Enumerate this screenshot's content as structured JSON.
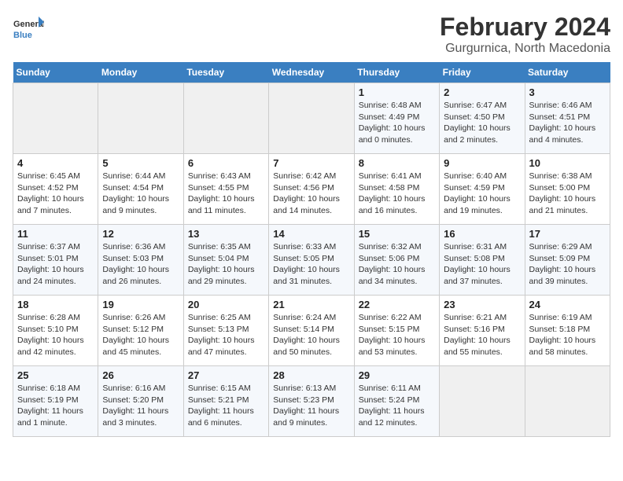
{
  "logo": {
    "line1": "General",
    "line2": "Blue"
  },
  "title": "February 2024",
  "subtitle": "Gurgurnica, North Macedonia",
  "days_header": [
    "Sunday",
    "Monday",
    "Tuesday",
    "Wednesday",
    "Thursday",
    "Friday",
    "Saturday"
  ],
  "weeks": [
    [
      {
        "day": "",
        "info": ""
      },
      {
        "day": "",
        "info": ""
      },
      {
        "day": "",
        "info": ""
      },
      {
        "day": "",
        "info": ""
      },
      {
        "day": "1",
        "info": "Sunrise: 6:48 AM\nSunset: 4:49 PM\nDaylight: 10 hours\nand 0 minutes."
      },
      {
        "day": "2",
        "info": "Sunrise: 6:47 AM\nSunset: 4:50 PM\nDaylight: 10 hours\nand 2 minutes."
      },
      {
        "day": "3",
        "info": "Sunrise: 6:46 AM\nSunset: 4:51 PM\nDaylight: 10 hours\nand 4 minutes."
      }
    ],
    [
      {
        "day": "4",
        "info": "Sunrise: 6:45 AM\nSunset: 4:52 PM\nDaylight: 10 hours\nand 7 minutes."
      },
      {
        "day": "5",
        "info": "Sunrise: 6:44 AM\nSunset: 4:54 PM\nDaylight: 10 hours\nand 9 minutes."
      },
      {
        "day": "6",
        "info": "Sunrise: 6:43 AM\nSunset: 4:55 PM\nDaylight: 10 hours\nand 11 minutes."
      },
      {
        "day": "7",
        "info": "Sunrise: 6:42 AM\nSunset: 4:56 PM\nDaylight: 10 hours\nand 14 minutes."
      },
      {
        "day": "8",
        "info": "Sunrise: 6:41 AM\nSunset: 4:58 PM\nDaylight: 10 hours\nand 16 minutes."
      },
      {
        "day": "9",
        "info": "Sunrise: 6:40 AM\nSunset: 4:59 PM\nDaylight: 10 hours\nand 19 minutes."
      },
      {
        "day": "10",
        "info": "Sunrise: 6:38 AM\nSunset: 5:00 PM\nDaylight: 10 hours\nand 21 minutes."
      }
    ],
    [
      {
        "day": "11",
        "info": "Sunrise: 6:37 AM\nSunset: 5:01 PM\nDaylight: 10 hours\nand 24 minutes."
      },
      {
        "day": "12",
        "info": "Sunrise: 6:36 AM\nSunset: 5:03 PM\nDaylight: 10 hours\nand 26 minutes."
      },
      {
        "day": "13",
        "info": "Sunrise: 6:35 AM\nSunset: 5:04 PM\nDaylight: 10 hours\nand 29 minutes."
      },
      {
        "day": "14",
        "info": "Sunrise: 6:33 AM\nSunset: 5:05 PM\nDaylight: 10 hours\nand 31 minutes."
      },
      {
        "day": "15",
        "info": "Sunrise: 6:32 AM\nSunset: 5:06 PM\nDaylight: 10 hours\nand 34 minutes."
      },
      {
        "day": "16",
        "info": "Sunrise: 6:31 AM\nSunset: 5:08 PM\nDaylight: 10 hours\nand 37 minutes."
      },
      {
        "day": "17",
        "info": "Sunrise: 6:29 AM\nSunset: 5:09 PM\nDaylight: 10 hours\nand 39 minutes."
      }
    ],
    [
      {
        "day": "18",
        "info": "Sunrise: 6:28 AM\nSunset: 5:10 PM\nDaylight: 10 hours\nand 42 minutes."
      },
      {
        "day": "19",
        "info": "Sunrise: 6:26 AM\nSunset: 5:12 PM\nDaylight: 10 hours\nand 45 minutes."
      },
      {
        "day": "20",
        "info": "Sunrise: 6:25 AM\nSunset: 5:13 PM\nDaylight: 10 hours\nand 47 minutes."
      },
      {
        "day": "21",
        "info": "Sunrise: 6:24 AM\nSunset: 5:14 PM\nDaylight: 10 hours\nand 50 minutes."
      },
      {
        "day": "22",
        "info": "Sunrise: 6:22 AM\nSunset: 5:15 PM\nDaylight: 10 hours\nand 53 minutes."
      },
      {
        "day": "23",
        "info": "Sunrise: 6:21 AM\nSunset: 5:16 PM\nDaylight: 10 hours\nand 55 minutes."
      },
      {
        "day": "24",
        "info": "Sunrise: 6:19 AM\nSunset: 5:18 PM\nDaylight: 10 hours\nand 58 minutes."
      }
    ],
    [
      {
        "day": "25",
        "info": "Sunrise: 6:18 AM\nSunset: 5:19 PM\nDaylight: 11 hours\nand 1 minute."
      },
      {
        "day": "26",
        "info": "Sunrise: 6:16 AM\nSunset: 5:20 PM\nDaylight: 11 hours\nand 3 minutes."
      },
      {
        "day": "27",
        "info": "Sunrise: 6:15 AM\nSunset: 5:21 PM\nDaylight: 11 hours\nand 6 minutes."
      },
      {
        "day": "28",
        "info": "Sunrise: 6:13 AM\nSunset: 5:23 PM\nDaylight: 11 hours\nand 9 minutes."
      },
      {
        "day": "29",
        "info": "Sunrise: 6:11 AM\nSunset: 5:24 PM\nDaylight: 11 hours\nand 12 minutes."
      },
      {
        "day": "",
        "info": ""
      },
      {
        "day": "",
        "info": ""
      }
    ]
  ]
}
